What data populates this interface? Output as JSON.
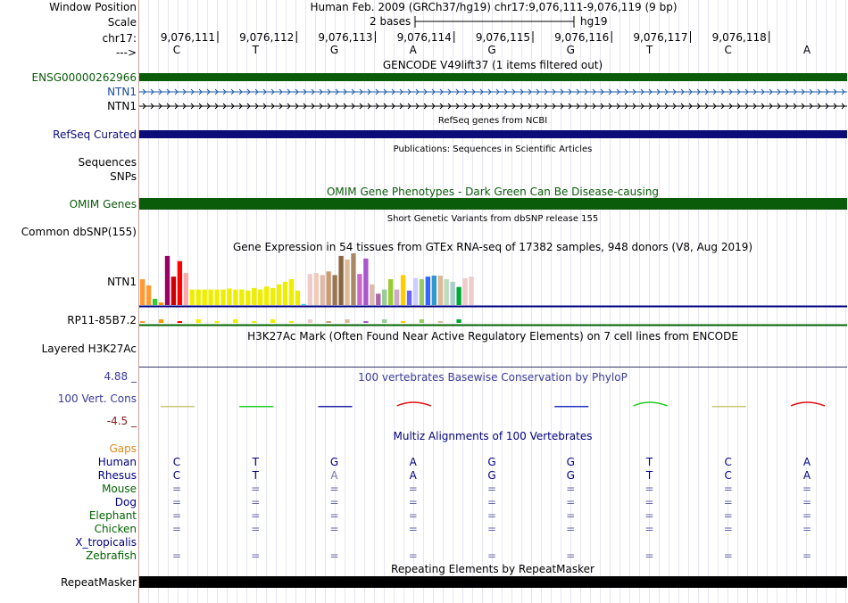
{
  "header": {
    "window_position_label": "Window Position",
    "window_position_value": "Human Feb. 2009 (GRCh37/hg19)   chr17:9,076,111-9,076,119 (9 bp)",
    "scale_label": "Scale",
    "scale_text": "2 bases",
    "scale_assembly": "hg19",
    "chrom_label": "chr17:",
    "strand_label": "--->",
    "positions": [
      "9,076,111",
      "9,076,112",
      "9,076,113",
      "9,076,114",
      "9,076,115",
      "9,076,116",
      "9,076,117",
      "9,076,118"
    ],
    "bases": [
      "C",
      "T",
      "G",
      "A",
      "G",
      "G",
      "T",
      "C",
      "A"
    ]
  },
  "tracks": {
    "gencode_title": "GENCODE V49lift37 (1 items filtered out)",
    "gencode_items": [
      "ENSG00000262966",
      "NTN1",
      "NTN1"
    ],
    "refseq_title": "RefSeq genes from NCBI",
    "refseq_label": "RefSeq Curated",
    "pubs_title": "Publications: Sequences in Scientific Articles",
    "sequences_label": "Sequences",
    "snps_label": "SNPs",
    "omim_title": "OMIM Gene Phenotypes - Dark Green Can Be Disease-causing",
    "omim_label": "OMIM Genes",
    "dbsnp_title": "Short Genetic Variants from dbSNP release 155",
    "dbsnp_label": "Common dbSNP(155)",
    "gtex_title": "Gene Expression in 54 tissues from GTEx RNA-seq of 17382 samples, 948 donors (V8, Aug 2019)",
    "gtex_gene1": "NTN1",
    "gtex_gene2": "RP11-85B7.2",
    "h3k_title": "H3K27Ac Mark (Often Found Near Active Regulatory Elements) on 7 cell lines from ENCODE",
    "h3k_label": "Layered H3K27Ac",
    "phylop_title": "100 vertebrates Basewise Conservation by PhyloP",
    "phylop_max": "4.88 _",
    "phylop_label": "100 Vert. Cons",
    "phylop_min": "-4.5 _",
    "multiz_title": "Multiz Alignments of 100 Vertebrates",
    "gaps_label": "Gaps",
    "species": [
      "Human",
      "Rhesus",
      "Mouse",
      "Dog",
      "Elephant",
      "Chicken",
      "X_tropicalis",
      "Zebrafish"
    ],
    "human_bases": [
      "C",
      "T",
      "G",
      "A",
      "G",
      "G",
      "T",
      "C",
      "A"
    ],
    "rhesus_bases": [
      "C",
      "T",
      "A",
      "A",
      "G",
      "G",
      "T",
      "C",
      "A"
    ],
    "eq_symbol": "=",
    "repeat_title": "Repeating Elements by RepeatMasker",
    "repeat_label": "RepeatMasker"
  },
  "gtex": {
    "values": [
      0.5,
      0.38,
      0.12,
      0.05,
      0.95,
      0.55,
      0.85,
      0.62,
      0.3,
      0.3,
      0.3,
      0.3,
      0.3,
      0.3,
      0.32,
      0.3,
      0.3,
      0.28,
      0.33,
      0.3,
      0.36,
      0.33,
      0.4,
      0.45,
      0.5,
      0.28,
      0.02,
      0.6,
      0.62,
      0.58,
      0.65,
      0.58,
      0.95,
      0.88,
      1.0,
      0.6,
      0.9,
      0.4,
      0.22,
      0.3,
      0.5,
      0.3,
      0.58,
      0.28,
      0.52,
      0.5,
      0.55,
      0.57,
      0.57,
      0.5,
      0.45,
      0.35,
      0.52,
      0.55
    ],
    "colors": [
      "#ff9933",
      "#ff9933",
      "#33cc33",
      "#ff9900",
      "#990066",
      "#cc0000",
      "#ff0000",
      "#ffaaaa",
      "#eeee00",
      "#eeee00",
      "#eeee00",
      "#eeee00",
      "#eeee00",
      "#eeee00",
      "#eeee00",
      "#eeee00",
      "#eeee00",
      "#eeee00",
      "#eeee00",
      "#eeee00",
      "#eeee00",
      "#eeee00",
      "#eeee00",
      "#eeee00",
      "#eeee00",
      "#eeee00",
      "#33ccff",
      "#eecccc",
      "#eeccbb",
      "#ddbbaa",
      "#cc9977",
      "#997755",
      "#886644",
      "#ddbb99",
      "#aa8866",
      "#cc66cc",
      "#aa55cc",
      "#ddbbaa",
      "#aa66aa",
      "#99cc99",
      "#99cc33",
      "#ccaacc",
      "#ffcc00",
      "#6666ff",
      "#ccccff",
      "#99cc66",
      "#3366ff",
      "#3399cc",
      "#ddbb99",
      "#bbddbb",
      "#aacccc",
      "#00aa33",
      "#eecccc",
      "#eecccc"
    ]
  },
  "colors": {
    "gencode": "#0a5b0a",
    "refseq": "#0c0c78",
    "omim": "#0a5b0a",
    "repeat": "#000000",
    "navy": "#000080",
    "darkgreen": "#006400",
    "label_gencode": "#0a5b0a",
    "label_ntn1": "#1a4b9a",
    "phylop_title": "#3a3a9a",
    "gaps": "#e08a1a"
  }
}
